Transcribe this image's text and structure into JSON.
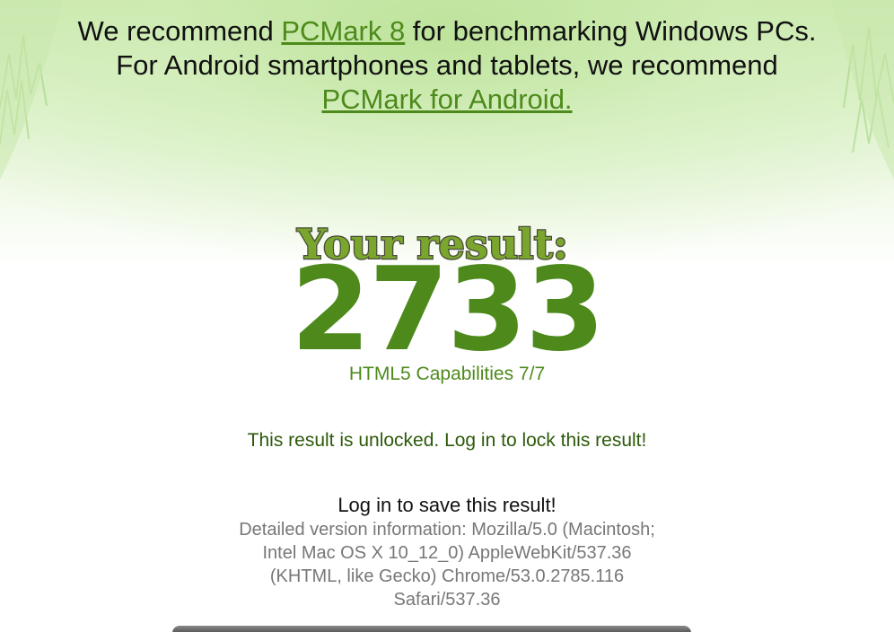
{
  "intro": {
    "line1_prefix": "We recommend ",
    "line1_link": "PCMark 8",
    "line1_suffix": " for benchmarking Windows PCs.",
    "line2": "For Android smartphones and tablets, we recommend",
    "line3_link": "PCMark for Android."
  },
  "result": {
    "heading": "Your result:",
    "score": "2733",
    "capabilities": "HTML5 Capabilities 7/7",
    "unlocked_message": "This result is unlocked. Log in to lock this result!",
    "save_message": "Log in to save this result!"
  },
  "version_info": {
    "lines": [
      "Detailed version information: Mozilla/5.0 (Macintosh;",
      "Intel Mac OS X 10_12_0) AppleWebKit/537.36",
      "(KHTML, like Gecko) Chrome/53.0.2785.116",
      "Safari/537.36"
    ]
  },
  "colors": {
    "accent_green": "#4d8a1b",
    "dark_green": "#2c5a0a",
    "heading_green": "#7aa62e",
    "heading_outline": "#4a4a3a"
  }
}
